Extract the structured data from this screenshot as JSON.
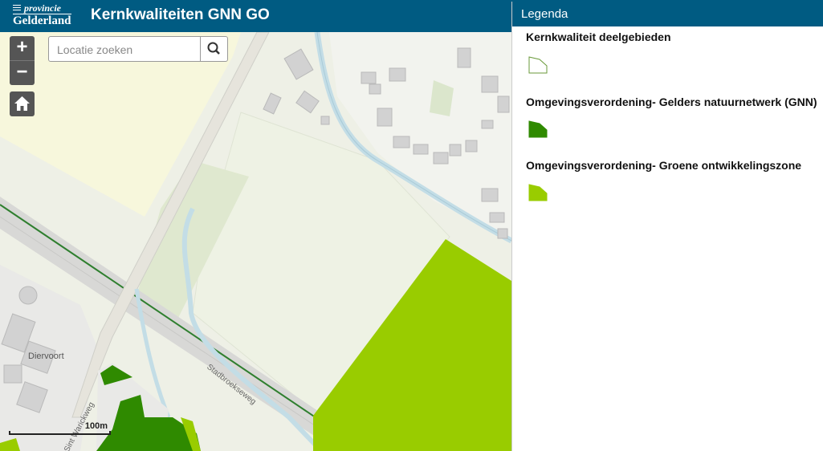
{
  "header": {
    "logo_small": "provincie",
    "logo_big": "Gelderland",
    "title": "Kernkwaliteiten GNN GO"
  },
  "map": {
    "search_placeholder": "Locatie zoeken",
    "zoom_in": "+",
    "zoom_out": "−",
    "labels": {
      "diervoort": "Diervoort",
      "stadbroekseweg": "Stadbroekseweg",
      "warwickweg": "Sint Warickweg"
    },
    "scale_label": "100m"
  },
  "legend": {
    "title": "Legenda",
    "items": [
      {
        "label": "Kernkwaliteit deelgebieden",
        "color": "#ffffff",
        "stroke": "#6a9a3a"
      },
      {
        "label": "Omgevingsverordening- Gelders natuurnetwerk (GNN)",
        "color": "#2f8a00",
        "stroke": "#2f8a00"
      },
      {
        "label": "Omgevingsverordening- Groene ontwikkelingszone",
        "color": "#99cc00",
        "stroke": "#99cc00"
      }
    ]
  },
  "icons": [
    "search-icon",
    "home-icon",
    "zoom-in-icon",
    "zoom-out-icon"
  ]
}
